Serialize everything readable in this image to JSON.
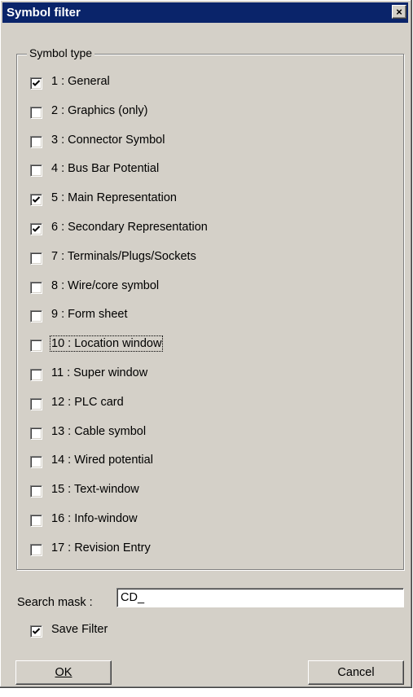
{
  "window": {
    "title": "Symbol filter",
    "close_label": "×"
  },
  "group": {
    "legend": "Symbol type",
    "items": [
      {
        "label": "1 : General",
        "checked": true
      },
      {
        "label": "2 : Graphics (only)",
        "checked": false
      },
      {
        "label": "3 : Connector Symbol",
        "checked": false
      },
      {
        "label": "4 : Bus Bar Potential",
        "checked": false
      },
      {
        "label": "5 : Main Representation",
        "checked": true
      },
      {
        "label": "6 : Secondary Representation",
        "checked": true
      },
      {
        "label": "7 : Terminals/Plugs/Sockets",
        "checked": false
      },
      {
        "label": "8 : Wire/core symbol",
        "checked": false
      },
      {
        "label": "9 : Form sheet",
        "checked": false
      },
      {
        "label": "10 : Location window",
        "checked": false,
        "focused": true
      },
      {
        "label": "11 : Super window",
        "checked": false
      },
      {
        "label": "12 : PLC card",
        "checked": false
      },
      {
        "label": "13 : Cable symbol",
        "checked": false
      },
      {
        "label": "14 : Wired potential",
        "checked": false
      },
      {
        "label": "15 : Text-window",
        "checked": false
      },
      {
        "label": "16 : Info-window",
        "checked": false
      },
      {
        "label": "17 : Revision Entry",
        "checked": false
      }
    ]
  },
  "search": {
    "label": "Search mask :",
    "value": "CD_"
  },
  "save_filter": {
    "label": "Save Filter",
    "checked": true
  },
  "buttons": {
    "ok": "OK",
    "cancel": "Cancel"
  }
}
